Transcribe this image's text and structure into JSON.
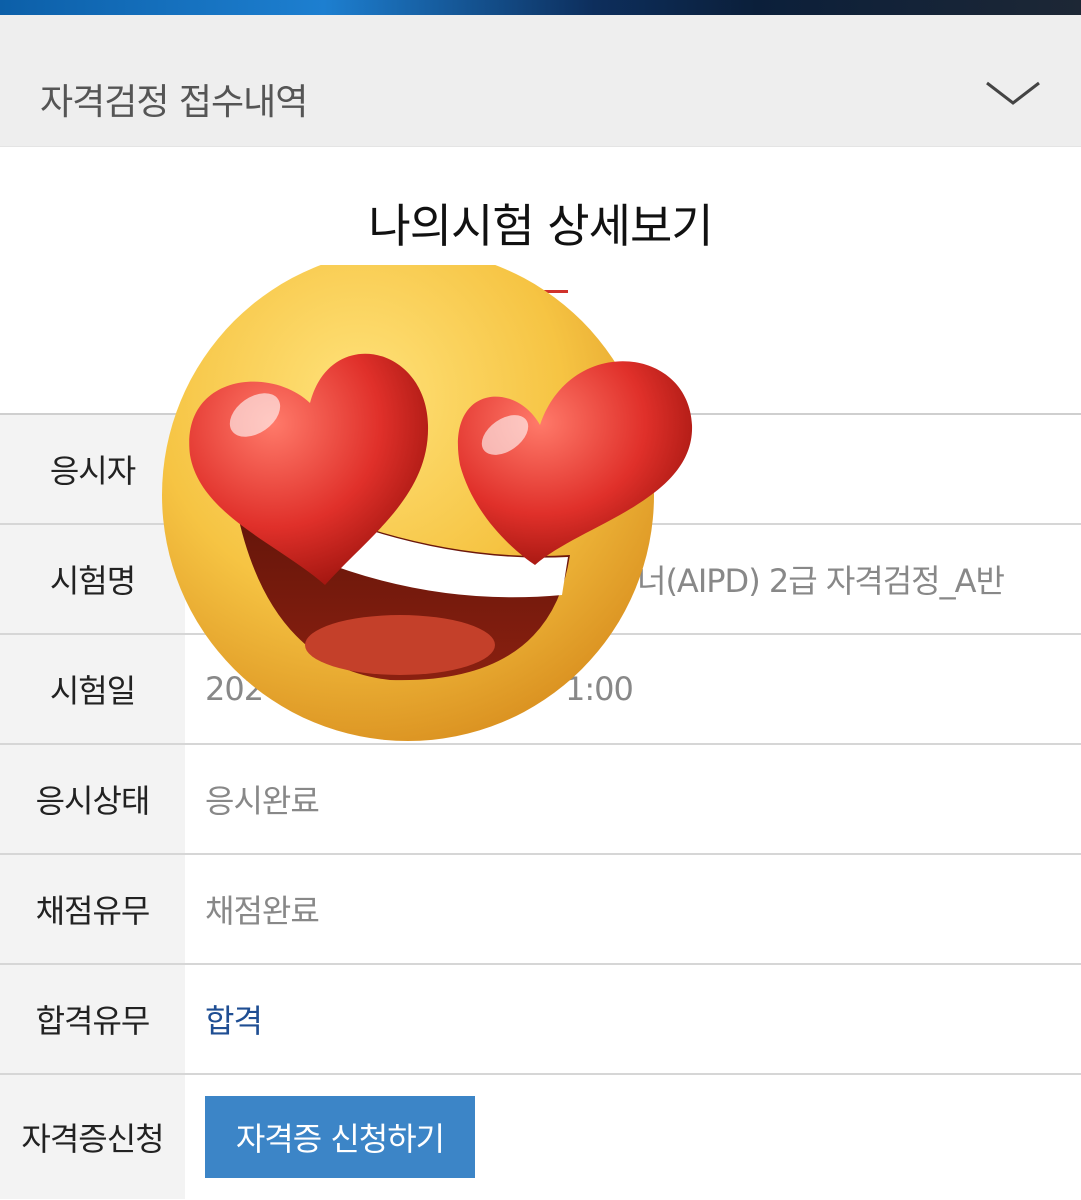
{
  "accordion": {
    "title": "자격검정 접수내역"
  },
  "page": {
    "title": "나의시험 상세보기"
  },
  "details": {
    "rows": [
      {
        "label": "응시자",
        "value": ""
      },
      {
        "label": "시험명",
        "value": "너(AIPD) 2급 자격검정_A반"
      },
      {
        "label": "시험일",
        "value": "202"
      },
      {
        "label": "응시상태",
        "value": "응시완료"
      },
      {
        "label": "채점유무",
        "value": "채점완료"
      },
      {
        "label": "합격유무",
        "value": "합격"
      },
      {
        "label": "자격증신청",
        "button": "자격증 신청하기"
      }
    ],
    "exam_time_fragment": "1:00"
  },
  "overlay": {
    "icon": "heart-eyes-emoji-icon"
  },
  "colors": {
    "accent_red": "#d0322b",
    "pass_blue": "#1f4e93",
    "button_blue": "#3c85c7"
  }
}
